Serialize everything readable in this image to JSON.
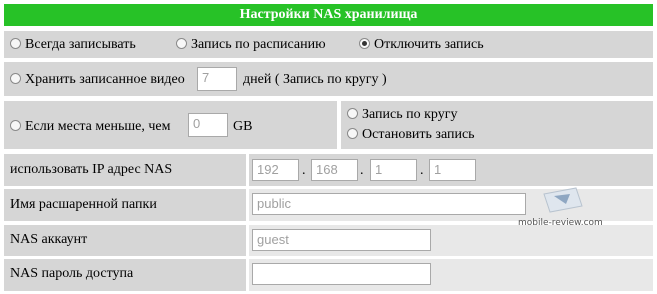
{
  "header": {
    "title": "Настройки NAS хранилища"
  },
  "record_mode": {
    "options": [
      "Всегда записывать",
      "Запись по расписанию",
      "Отключить запись"
    ],
    "selected": "Отключить запись"
  },
  "keep_video": {
    "label_before": "Хранить записанное видео",
    "value": "7",
    "label_after": "дней ( Запись по кругу )"
  },
  "space": {
    "label_before": "Если места меньше, чем",
    "value": "0",
    "unit": "GB",
    "options": [
      "Запись по кругу",
      "Остановить запись"
    ]
  },
  "nas_ip": {
    "label": "использовать IP адрес NAS",
    "octets": [
      "192",
      "168",
      "1",
      "1"
    ]
  },
  "folder": {
    "label": "Имя расшаренной папки",
    "value": "public"
  },
  "account": {
    "label": "NAS аккаунт",
    "value": "guest"
  },
  "password": {
    "label": "NAS пароль доступа",
    "value": ""
  },
  "watermark": {
    "text": "mobile-review.com"
  }
}
